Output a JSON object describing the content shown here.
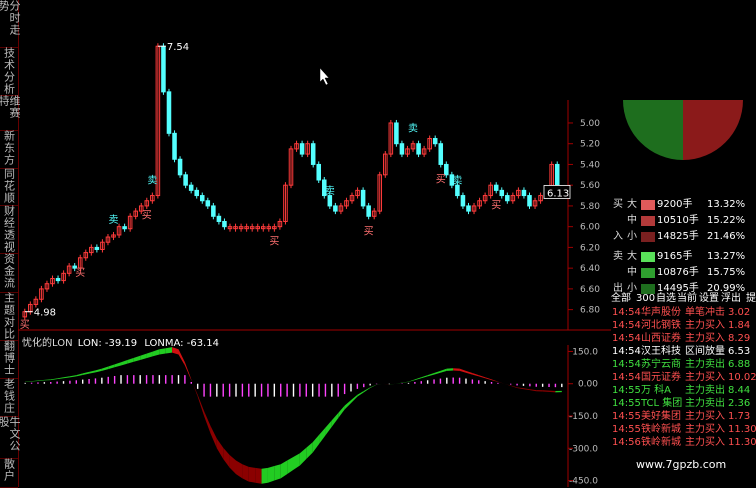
{
  "toolbar": {
    "tabs": [
      {
        "label": "分时走势"
      },
      {
        "label": "技术分析"
      },
      {
        "label": "维赛特"
      },
      {
        "label": "新东方"
      },
      {
        "label": "同花顺"
      },
      {
        "label": "财经透视"
      },
      {
        "label": "资金流"
      },
      {
        "label": "主题对比"
      },
      {
        "label": "翻博士"
      },
      {
        "label": "老钱庄"
      },
      {
        "label": "牛文公股"
      },
      {
        "label": "散户"
      }
    ]
  },
  "price_chart": {
    "y_ticks": [
      "6.80",
      "6.60",
      "6.40",
      "6.20",
      "6.00",
      "5.80",
      "5.60",
      "5.40",
      "5.20",
      "5.00"
    ],
    "high_label": "7.54",
    "low_label": "4.98",
    "last_label": "6.13",
    "signal_buy": "买",
    "signal_sell": "卖",
    "colors": {
      "up": "#ff3b3b",
      "down": "#54ffff",
      "axis": "#a00000",
      "text": "#ddd"
    }
  },
  "indicator": {
    "title_name": "忧化的LON",
    "title_lon": "LON: -39.19",
    "title_lonma": "LONMA: -63.14",
    "y_ticks": [
      "150.0",
      "0.00",
      "-150.0",
      "-300.0",
      "-450.0"
    ],
    "colors": {
      "pos_ma": "#d01010",
      "neg_ma": "#8b0000",
      "rise": "#22cc22",
      "bar": "#ff44ff"
    }
  },
  "chart_data": [
    {
      "type": "line",
      "title": "",
      "xlabel": "",
      "ylabel": "",
      "ylim": [
        4.9,
        7.6
      ],
      "y_ticks": [
        5.0,
        5.2,
        5.4,
        5.6,
        5.8,
        6.0,
        6.2,
        6.4,
        6.6,
        6.8
      ],
      "series": [
        {
          "values": [
            4.98,
            5.05,
            5.1,
            5.2,
            5.25,
            5.3,
            5.28,
            5.35,
            5.42,
            5.4,
            5.5,
            5.55,
            5.6,
            5.58,
            5.65,
            5.7,
            5.72,
            5.8,
            5.78,
            5.9,
            5.95,
            6.0,
            6.05,
            6.1,
            7.54,
            7.1,
            6.7,
            6.45,
            6.3,
            6.2,
            6.15,
            6.1,
            6.05,
            6.0,
            5.9,
            5.85,
            5.8,
            5.8,
            5.8,
            5.8,
            5.8,
            5.8,
            5.8,
            5.8,
            5.8,
            5.8,
            5.85,
            6.2,
            6.55,
            6.6,
            6.5,
            6.6,
            6.4,
            6.25,
            6.1,
            6.0,
            5.95,
            6.0,
            6.05,
            6.1,
            6.15,
            6.0,
            5.9,
            5.95,
            6.3,
            6.5,
            6.8,
            6.6,
            6.5,
            6.55,
            6.6,
            6.5,
            6.55,
            6.65,
            6.6,
            6.4,
            6.3,
            6.2,
            6.1,
            6.0,
            5.95,
            6.0,
            6.05,
            6.1,
            6.2,
            6.15,
            6.1,
            6.05,
            6.1,
            6.15,
            6.1,
            6.0,
            6.05,
            6.1,
            6.13,
            6.4,
            6.13
          ]
        }
      ]
    },
    {
      "type": "bar",
      "title": "",
      "xlabel": "",
      "ylabel": "",
      "ylim": [
        -480,
        180
      ],
      "y_ticks": [
        150,
        0,
        -150,
        -300,
        -450
      ],
      "series": [
        {
          "values": [
            10,
            12,
            15,
            18,
            20,
            25,
            30,
            35,
            40,
            48,
            55,
            62,
            70,
            80,
            90,
            100,
            110,
            120,
            130,
            140,
            150,
            160,
            165,
            170,
            160,
            100,
            20,
            -60,
            -150,
            -230,
            -300,
            -350,
            -390,
            -420,
            -440,
            -455,
            -460,
            -465,
            -460,
            -450,
            -440,
            -420,
            -400,
            -380,
            -350,
            -320,
            -280,
            -240,
            -200,
            -160,
            -120,
            -90,
            -60,
            -40,
            -20,
            -5,
            0,
            -5,
            0,
            5,
            10,
            20,
            30,
            40,
            50,
            60,
            70,
            72,
            70,
            60,
            50,
            40,
            30,
            20,
            10,
            0,
            -10,
            -20,
            -25,
            -30,
            -35,
            -36,
            -38,
            -40,
            -39.19
          ]
        }
      ]
    }
  ],
  "right_panel": {
    "pie_colors": {
      "buy": "#8b1a1a",
      "sell": "#1e6e1e"
    },
    "buy_label": "买入",
    "sell_label": "卖出",
    "buy_rows": [
      {
        "size": "大",
        "vol": "9200手",
        "pct": "13.32%",
        "color": "#e05a5a"
      },
      {
        "size": "中",
        "vol": "10510手",
        "pct": "15.22%",
        "color": "#b33a3a"
      },
      {
        "size": "小",
        "vol": "14825手",
        "pct": "21.46%",
        "color": "#7a2020"
      }
    ],
    "sell_rows": [
      {
        "size": "大",
        "vol": "9165手",
        "pct": "13.27%",
        "color": "#59e059"
      },
      {
        "size": "中",
        "vol": "10876手",
        "pct": "15.75%",
        "color": "#2fa02f"
      },
      {
        "size": "小",
        "vol": "14495手",
        "pct": "20.99%",
        "color": "#1e6e1e"
      }
    ],
    "filter_tabs": [
      "全部",
      "300",
      "自选",
      "当前",
      "设置",
      "浮出",
      "提"
    ],
    "ticker": [
      {
        "time": "14:54",
        "name": "华声股份",
        "type": "单笔冲击",
        "val": "3.02",
        "color": "#ff5050"
      },
      {
        "time": "14:54",
        "name": "河北钢铁",
        "type": "主力买入",
        "val": "1.84",
        "color": "#ff5050"
      },
      {
        "time": "14:54",
        "name": "山西证券",
        "type": "主力买入",
        "val": "8.29",
        "color": "#ff5050"
      },
      {
        "time": "14:54",
        "name": "汉王科技",
        "type": "区间放量",
        "val": "6.53",
        "color": "#ffffff"
      },
      {
        "time": "14:54",
        "name": "苏宁云商",
        "type": "主力卖出",
        "val": "6.88",
        "color": "#40e040"
      },
      {
        "time": "14:54",
        "name": "国元证券",
        "type": "主力买入",
        "val": "10.02",
        "color": "#ff5050"
      },
      {
        "time": "14:55",
        "name": "万 科A",
        "type": "主力卖出",
        "val": "8.44",
        "color": "#40e040"
      },
      {
        "time": "14:55",
        "name": "TCL 集团",
        "type": "主力卖出",
        "val": "2.36",
        "color": "#40e040"
      },
      {
        "time": "14:55",
        "name": "美好集团",
        "type": "主力买入",
        "val": "1.73",
        "color": "#ff5050"
      },
      {
        "time": "14:55",
        "name": "铁岭新城",
        "type": "主力买入",
        "val": "11.30",
        "color": "#ff5050"
      },
      {
        "time": "14:56",
        "name": "铁岭新城",
        "type": "主力买入",
        "val": "11.30",
        "color": "#ff5050"
      }
    ]
  },
  "watermark": "www.7gpzb.com"
}
